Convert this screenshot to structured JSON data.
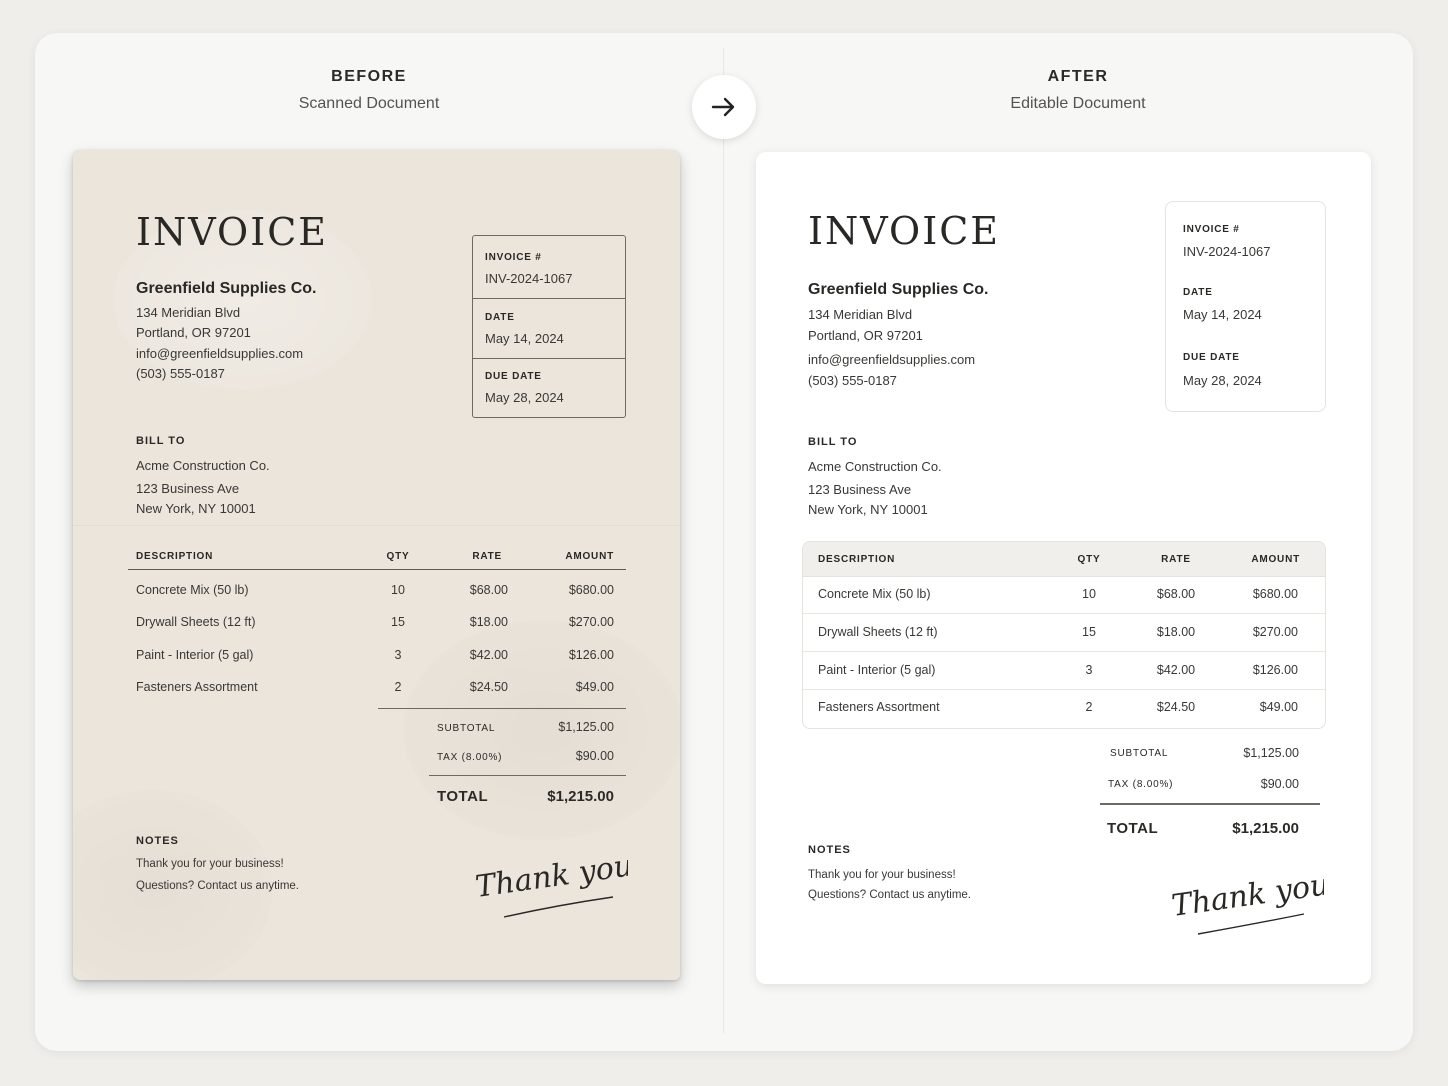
{
  "before": {
    "label": "BEFORE",
    "subtitle": "Scanned Document"
  },
  "after": {
    "label": "AFTER",
    "subtitle": "Editable Document"
  },
  "arrow_icon": "arrow-right-icon",
  "invoice": {
    "title": "INVOICE",
    "company": "Greenfield Supplies Co.",
    "address1": "134 Meridian Blvd",
    "address2": "Portland, OR 97201",
    "email": "info@greenfieldsupplies.com",
    "phone": "(503) 555-0187",
    "invoice_no_label": "INVOICE #",
    "invoice_no": "INV-2024-1067",
    "date_label": "DATE",
    "date": "May 14, 2024",
    "due_label": "DUE DATE",
    "due": "May 28, 2024",
    "bill_to_label": "BILL TO",
    "bill_name": "Acme Construction Co.",
    "bill_addr1": "123 Business Ave",
    "bill_addr2": "New York, NY 10001",
    "columns": {
      "description": "DESCRIPTION",
      "qty": "QTY",
      "rate": "RATE",
      "amount": "AMOUNT"
    },
    "items": [
      {
        "description": "Concrete Mix (50 lb)",
        "qty": "10",
        "rate": "$68.00",
        "amount": "$680.00"
      },
      {
        "description": "Drywall Sheets (12 ft)",
        "qty": "15",
        "rate": "$18.00",
        "amount": "$270.00"
      },
      {
        "description": "Paint - Interior (5 gal)",
        "qty": "3",
        "rate": "$42.00",
        "amount": "$126.00"
      },
      {
        "description": "Fasteners Assortment",
        "qty": "2",
        "rate": "$24.50",
        "amount": "$49.00"
      }
    ],
    "subtotal_label": "SUBTOTAL",
    "subtotal": "$1,125.00",
    "tax_label": "TAX (8.00%)",
    "tax": "$90.00",
    "total_label": "TOTAL",
    "total": "$1,215.00",
    "notes_label": "NOTES",
    "notes1": "Thank you for your business!",
    "notes2": "Questions? Contact us anytime.",
    "signature": "Thank you!"
  }
}
